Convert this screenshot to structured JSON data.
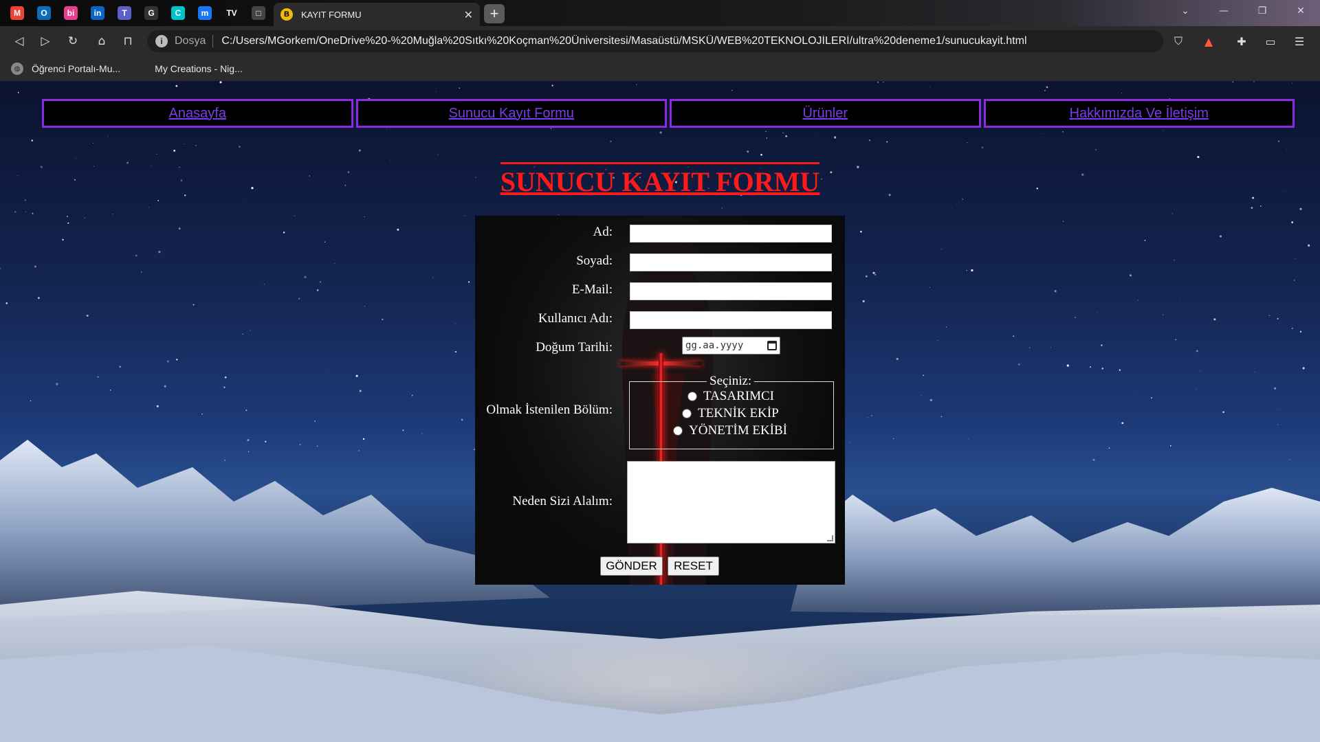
{
  "browser": {
    "tab_title": "KAYIT FORMU",
    "tab_favicon": "B",
    "pinned_tabs": [
      {
        "name": "gmail-icon",
        "glyph": "M",
        "color": "#ea4335"
      },
      {
        "name": "outlook-icon",
        "glyph": "O",
        "color": "#0f6cbd"
      },
      {
        "name": "bi-icon",
        "glyph": "bi",
        "color": "#e83e8c"
      },
      {
        "name": "linkedin-icon",
        "glyph": "in",
        "color": "#0a66c2"
      },
      {
        "name": "teams-icon",
        "glyph": "T",
        "color": "#5b5fc7"
      },
      {
        "name": "github-icon",
        "glyph": "G",
        "color": "#333333"
      },
      {
        "name": "canva-icon",
        "glyph": "C",
        "color": "#00c4cc"
      },
      {
        "name": "messenger-icon",
        "glyph": "m",
        "color": "#1877f2"
      },
      {
        "name": "tv-icon",
        "glyph": "TV",
        "color": "#111111"
      },
      {
        "name": "screenshot-icon",
        "glyph": "□",
        "color": "#444444"
      }
    ],
    "address_label": "Dosya",
    "url": "C:/Users/MGorkem/OneDrive%20-%20Muğla%20Sıtkı%20Koçman%20Üniversitesi/Masaüstü/MSKÜ/WEB%20TEKNOLOJİLERİ/ultra%20deneme1/sunucukayit.html",
    "bookmarks": [
      "Öğrenci Portalı-Mu...",
      "My Creations - Nig..."
    ]
  },
  "nav": [
    "Anasayfa",
    "Sunucu Kayıt Formu",
    "Ürünler",
    "Hakkımızda Ve İletişim"
  ],
  "title": "SUNUCU KAYIT FORMU",
  "form": {
    "ad_label": "Ad:",
    "soyad_label": "Soyad:",
    "email_label": "E-Mail:",
    "kullanici_label": "Kullanıcı Adı:",
    "dogum_label": "Doğum Tarihi:",
    "date_placeholder": "gg.aa.yyyy",
    "bolum_label": "Olmak İstenilen Bölüm:",
    "legend": "Seçiniz:",
    "options": [
      "TASARIMCI",
      "TEKNİK EKİP",
      "YÖNETİM EKİBİ"
    ],
    "neden_label": "Neden Sizi Alalım:",
    "submit": "GÖNDER",
    "reset": "RESET"
  },
  "colors": {
    "nav_border": "#8a2be2",
    "nav_link": "#7c3aed",
    "title": "#ff1a1a"
  }
}
